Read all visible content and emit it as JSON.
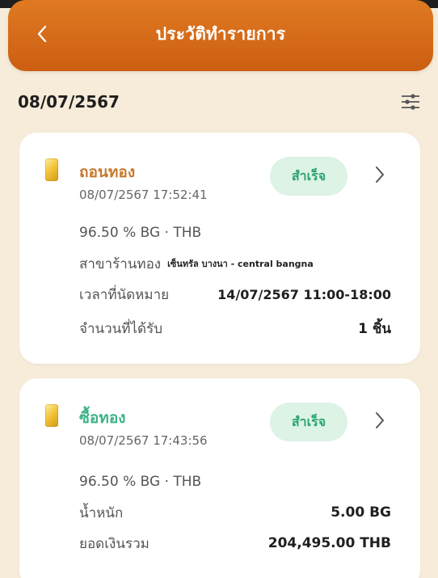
{
  "header": {
    "title": "ประวัติทำรายการ"
  },
  "date_group": {
    "date": "08/07/2567"
  },
  "transactions": [
    {
      "type": "ถอนทอง",
      "datetime": "08/07/2567 17:52:41",
      "status": "สำเร็จ",
      "product": "96.50 % BG · THB",
      "branch_label": "สาขาร้านทอง",
      "branch_value": "เซ็นทรัล บางนา - central bangna",
      "appointment_label": "เวลาที่นัดหมาย",
      "appointment_value": "14/07/2567 11:00-18:00",
      "quantity_label": "จำนวนที่ได้รับ",
      "quantity_value": "1  ชิ้น"
    },
    {
      "type": "ซื้อทอง",
      "datetime": "08/07/2567 17:43:56",
      "status": "สำเร็จ",
      "product": "96.50 % BG · THB",
      "weight_label": "น้ำหนัก",
      "weight_value": "5.00  BG",
      "total_label": "ยอดเงินรวม",
      "total_value": "204,495.00  THB"
    }
  ],
  "colors": {
    "header_orange": "#d8691a",
    "success_bg": "#dcf3e6",
    "success_text": "#2aa36e",
    "withdraw_text": "#c67a2c",
    "buy_text": "#3fb487",
    "page_bg": "#f6ecd9"
  },
  "icons": {
    "back": "chevron-left-icon",
    "filter": "filter-sliders-icon",
    "detail": "chevron-right-icon",
    "gold": "gold-bar-icon"
  }
}
